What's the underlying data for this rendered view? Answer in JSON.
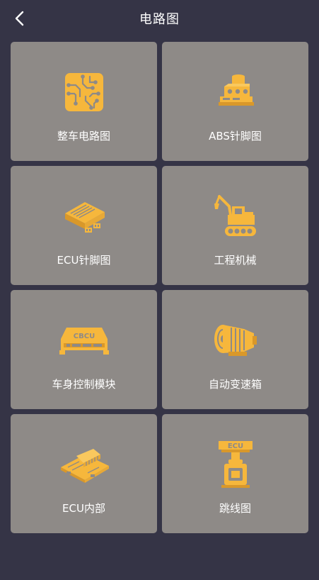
{
  "header": {
    "title": "电路图",
    "back_icon": "chevron-left-icon"
  },
  "theme": {
    "background": "#353446",
    "card": "#8e8a87",
    "accent": "#f6b73c",
    "text": "#ffffff"
  },
  "grid": {
    "items": [
      {
        "label": "整车电路图",
        "icon": "circuit-board-icon"
      },
      {
        "label": "ABS针脚图",
        "icon": "abs-module-icon"
      },
      {
        "label": "ECU针脚图",
        "icon": "ecu-module-icon"
      },
      {
        "label": "工程机械",
        "icon": "excavator-icon"
      },
      {
        "label": "车身控制模块",
        "icon": "cbcu-module-icon"
      },
      {
        "label": "自动变速箱",
        "icon": "transmission-icon"
      },
      {
        "label": "ECU内部",
        "icon": "ecu-internal-board-icon"
      },
      {
        "label": "跳线图",
        "icon": "ecu-jumper-cable-icon"
      }
    ]
  }
}
